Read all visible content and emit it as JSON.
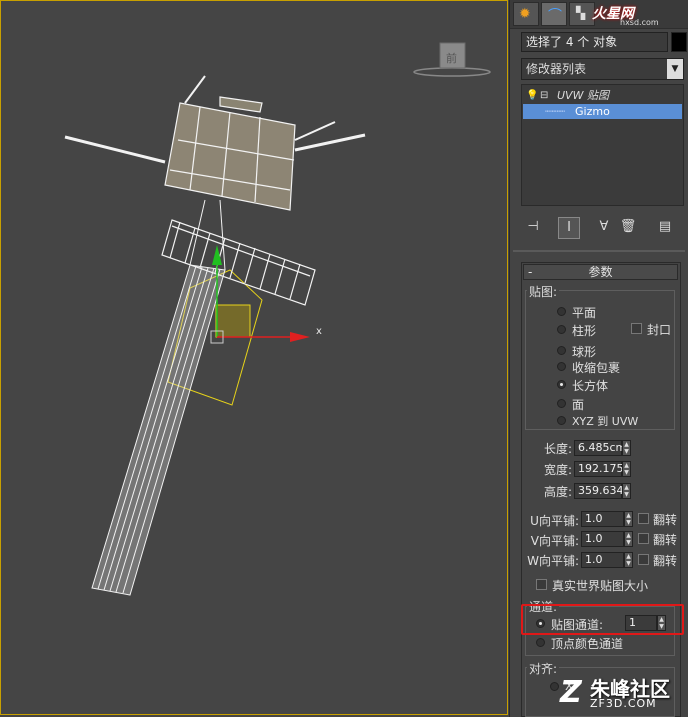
{
  "viewport": {
    "nav_cube_label": "前",
    "axis_x_label": "x",
    "colors": {
      "background": "#454545",
      "wire": "#f2f2f2",
      "gizmo": "#e6d21a",
      "axis_x": "#e02020",
      "axis_y": "#20c020"
    }
  },
  "command_panel": {
    "tabs": [
      "create-icon",
      "modify-icon",
      "hierarchy-icon"
    ],
    "logo": "火星网",
    "logo_sub": "hxsd.com",
    "selection_text": "选择了 4 个 对象",
    "modifier_list": "修改器列表",
    "stack": {
      "items": [
        {
          "label": "UVW 贴图",
          "selected": false
        },
        {
          "label": "Gizmo",
          "selected": true
        }
      ]
    },
    "toolbar_icons": [
      "pin-stack-icon",
      "show-end-result-icon",
      "make-unique-icon",
      "remove-modifier-icon",
      "configure-sets-icon"
    ]
  },
  "params": {
    "rollout_title": "参数",
    "rollout_minus": "-",
    "mapping_group": "贴图:",
    "mapping_options": [
      {
        "label": "平面",
        "checked": false
      },
      {
        "label": "柱形",
        "checked": false
      },
      {
        "label": "球形",
        "checked": false
      },
      {
        "label": "收缩包裹",
        "checked": false
      },
      {
        "label": "长方体",
        "checked": true
      },
      {
        "label": "面",
        "checked": false
      },
      {
        "label": "XYZ 到 UVW",
        "checked": false
      }
    ],
    "cap_label": "封口",
    "length_label": "长度:",
    "length_value": "6.485cm",
    "width_label": "宽度:",
    "width_value": "192.175",
    "height_label": "高度:",
    "height_value": "359.634",
    "u_tile_label": "U向平铺:",
    "u_tile_value": "1.0",
    "v_tile_label": "V向平铺:",
    "v_tile_value": "1.0",
    "w_tile_label": "W向平铺:",
    "w_tile_value": "1.0",
    "flip_label": "翻转",
    "real_world_label": "真实世界贴图大小",
    "channel_group": "通道:",
    "map_channel_label": "贴图通道:",
    "map_channel_value": "1",
    "vertex_color_label": "顶点颜色通道",
    "align_group": "对齐:",
    "align_partial": "X"
  },
  "watermark": {
    "text": "朱峰社区",
    "sub": "ZF3D.COM"
  }
}
